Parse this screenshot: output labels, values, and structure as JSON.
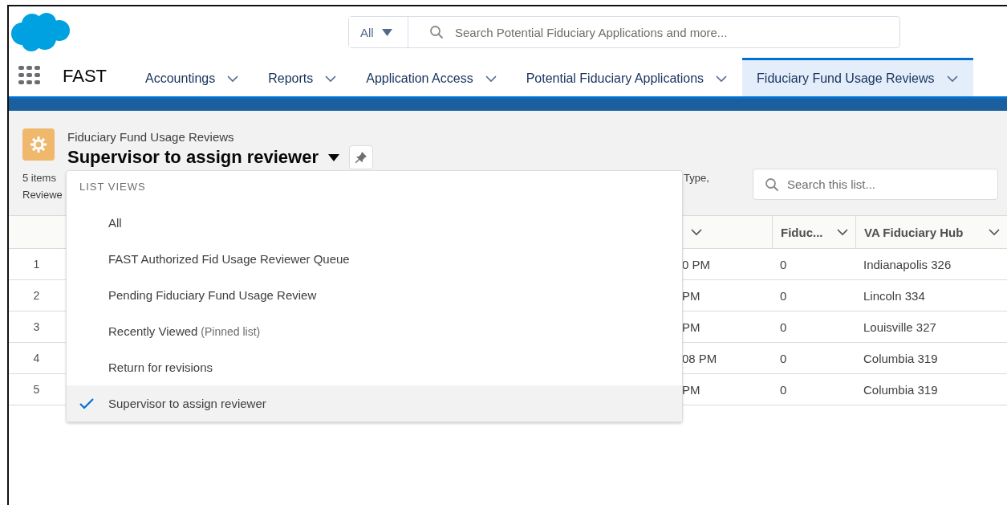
{
  "global_search": {
    "scope": "All",
    "placeholder": "Search Potential Fiduciary Applications and more..."
  },
  "nav": {
    "app_name": "FAST",
    "tabs": [
      {
        "label": "Accountings",
        "selected": false
      },
      {
        "label": "Reports",
        "selected": false
      },
      {
        "label": "Application Access",
        "selected": false
      },
      {
        "label": "Potential Fiduciary Applications",
        "selected": false
      },
      {
        "label": "Fiduciary Fund Usage Reviews",
        "selected": true
      }
    ]
  },
  "list_header": {
    "object_label": "Fiduciary Fund Usage Reviews",
    "title": "Supervisor to assign reviewer",
    "summary_line_1": "5 items",
    "summary_line_2": "Reviewe",
    "summary_fragment": "Type,",
    "search_placeholder": "Search this list..."
  },
  "table": {
    "columns": [
      {
        "label": "Fiduc..."
      },
      {
        "label": "VA Fiduciary Hub"
      }
    ],
    "rows": [
      {
        "number": "1",
        "column_3": "0 PM",
        "cells": [
          "0",
          "Indianapolis 326"
        ]
      },
      {
        "number": "2",
        "column_3": "PM",
        "cells": [
          "0",
          "Lincoln 334"
        ]
      },
      {
        "number": "3",
        "column_3": "PM",
        "cells": [
          "0",
          "Louisville 327"
        ]
      },
      {
        "number": "4",
        "column_3": "08 PM",
        "cells": [
          "0",
          "Columbia 319"
        ]
      },
      {
        "number": "5",
        "column_3": "PM",
        "cells": [
          "0",
          "Columbia 319"
        ]
      }
    ]
  },
  "list_views_menu": {
    "heading": "LIST VIEWS",
    "items": [
      {
        "label": "All",
        "selected": false
      },
      {
        "label": "FAST Authorized Fid Usage Reviewer Queue",
        "selected": false
      },
      {
        "label": "Pending Fiduciary Fund Usage Review",
        "selected": false
      },
      {
        "label": "Recently Viewed",
        "note": "(Pinned list)",
        "selected": false
      },
      {
        "label": "Return for revisions",
        "selected": false
      },
      {
        "label": "Supervisor to assign reviewer",
        "selected": true
      }
    ]
  }
}
